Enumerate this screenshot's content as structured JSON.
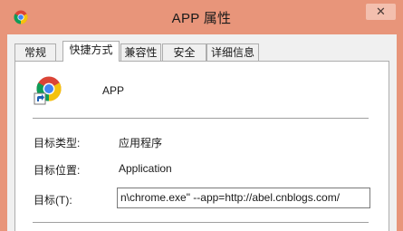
{
  "window": {
    "title": "APP 属性",
    "close_glyph": "✕",
    "app_icon": "chrome-icon"
  },
  "tabs": [
    {
      "label": "常规",
      "active": false
    },
    {
      "label": "快捷方式",
      "active": true
    },
    {
      "label": "兼容性",
      "active": false
    },
    {
      "label": "安全",
      "active": false
    },
    {
      "label": "详细信息",
      "active": false
    }
  ],
  "shortcut": {
    "icon": "chrome-shortcut-icon",
    "name": "APP",
    "target_type_label": "目标类型:",
    "target_type_value": "应用程序",
    "target_location_label": "目标位置:",
    "target_location_value": "Application",
    "target_label": "目标(T):",
    "target_value": "n\\chrome.exe\" --app=http://abel.cnblogs.com/"
  },
  "colors": {
    "titlebar": "#e8957a",
    "panel": "#ffffff",
    "dialog": "#f0f0f0"
  }
}
